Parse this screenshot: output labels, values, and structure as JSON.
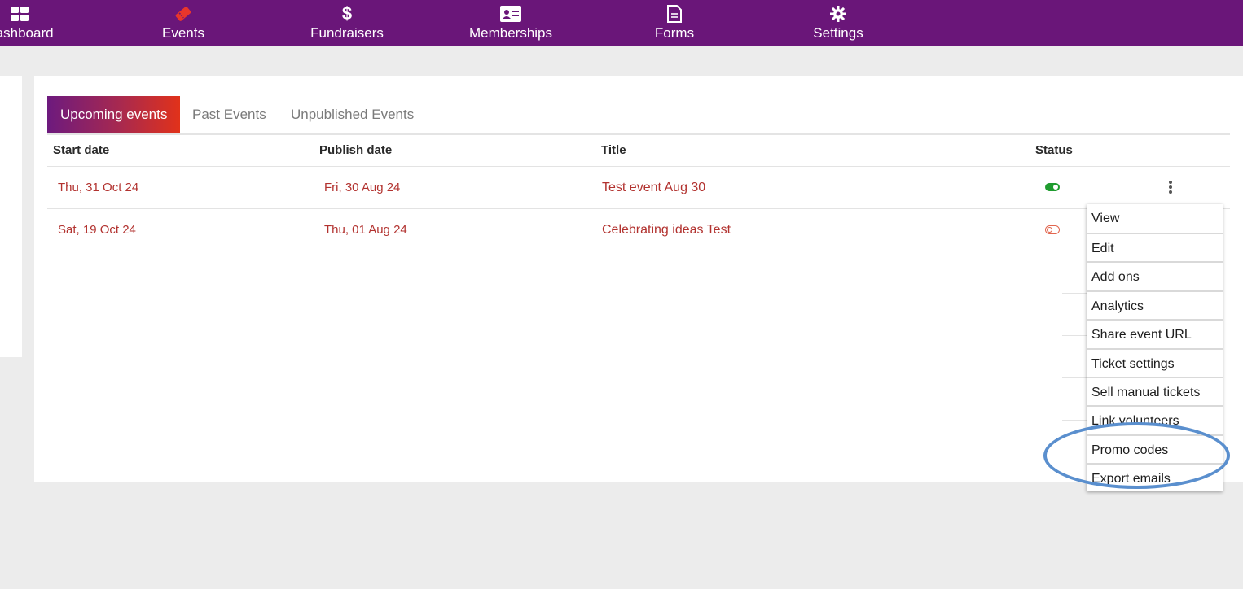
{
  "nav": {
    "items": [
      {
        "label": "Dashboard",
        "icon": "dashboard-icon"
      },
      {
        "label": "Events",
        "icon": "ticket-icon"
      },
      {
        "label": "Fundraisers",
        "icon": "dollar-icon"
      },
      {
        "label": "Memberships",
        "icon": "id-card-icon"
      },
      {
        "label": "Forms",
        "icon": "document-icon"
      },
      {
        "label": "Settings",
        "icon": "gear-icon"
      }
    ],
    "active_color": "#e8362b",
    "bg_color": "#6a1679"
  },
  "tabs": [
    {
      "label": "Upcoming events",
      "active": true
    },
    {
      "label": "Past Events",
      "active": false
    },
    {
      "label": "Unpublished Events",
      "active": false
    }
  ],
  "table": {
    "headers": [
      "Start date",
      "Publish date",
      "Title",
      "Status"
    ],
    "rows": [
      {
        "start_date": "Thu, 31 Oct 24",
        "publish_date": "Fri, 30 Aug 24",
        "title": "Test event Aug 30",
        "status": "published"
      },
      {
        "start_date": "Sat, 19 Oct 24",
        "publish_date": "Thu, 01 Aug 24",
        "title": "Celebrating ideas Test",
        "status": "unpublished"
      }
    ]
  },
  "menu": {
    "items": [
      "View",
      "Edit",
      "Add ons",
      "Analytics",
      "Share event URL",
      "Ticket settings",
      "Sell manual tickets",
      "Link volunteers",
      "Promo codes",
      "Export emails"
    ],
    "highlighted": [
      "Promo codes",
      "Export emails"
    ],
    "highlight_color": "#5a8fce"
  }
}
